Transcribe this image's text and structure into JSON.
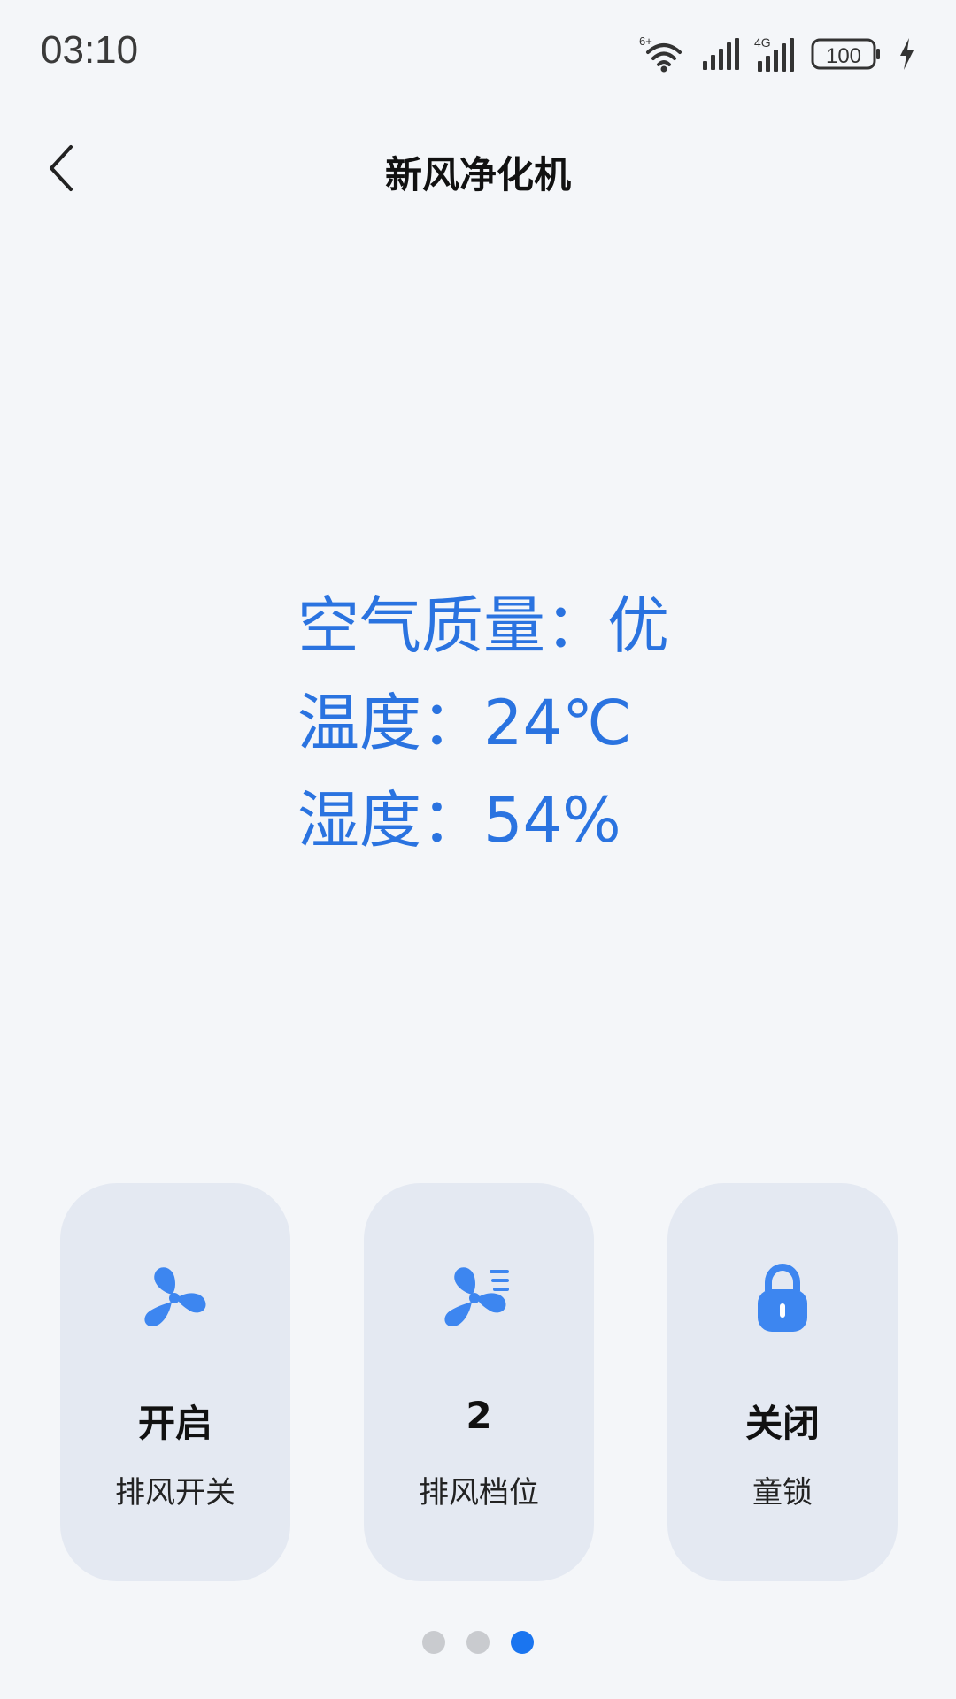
{
  "status_bar": {
    "time": "03:10",
    "wifi_badge": "6+",
    "network_type": "4G",
    "battery": "100"
  },
  "header": {
    "title": "新风净化机"
  },
  "readings": {
    "air_quality": "空气质量：优",
    "temperature": "温度：24℃",
    "humidity": "湿度：54%"
  },
  "cards": [
    {
      "value": "开启",
      "label": "排风开关",
      "icon": "fan-icon"
    },
    {
      "value": "2",
      "label": "排风档位",
      "icon": "fan-speed-icon"
    },
    {
      "value": "关闭",
      "label": "童锁",
      "icon": "lock-icon"
    }
  ],
  "page_indicator": {
    "count": 3,
    "active_index": 2
  },
  "colors": {
    "accent": "#2a73e0",
    "icon_blue": "#3d86f0",
    "card_bg": "#e4e9f2",
    "page_bg": "#f4f6f9",
    "dot_active": "#1a75f0",
    "dot_inactive": "#c9cbcf"
  }
}
